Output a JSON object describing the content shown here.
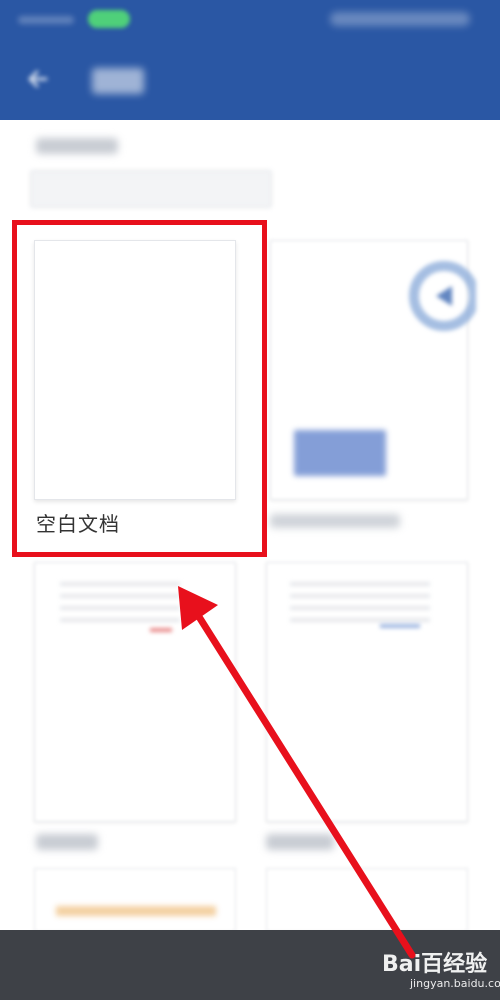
{
  "blank_document": {
    "label": "空白文档"
  },
  "watermark": {
    "logo_text": "Bai百经验",
    "url": "jingyan.baidu.com"
  },
  "annotation": {
    "highlight_color": "#e8101c",
    "arrow_color": "#e8101c"
  },
  "colors": {
    "app_bar": "#2a57a4",
    "bottom_bar": "#3e4147"
  }
}
